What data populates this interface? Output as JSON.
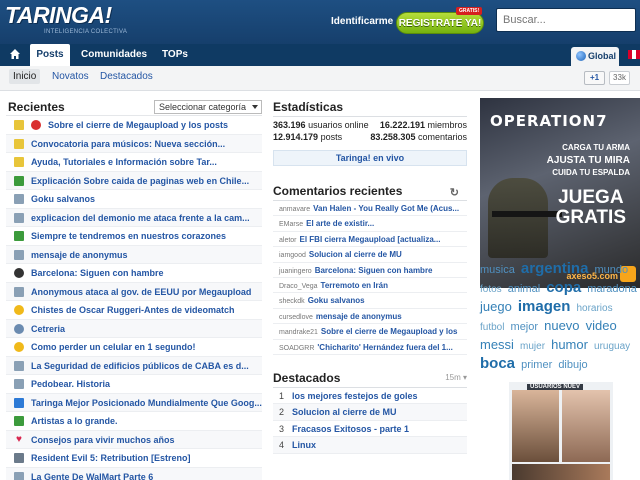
{
  "header": {
    "logo": "TARINGA!",
    "logo_sub": "INTELIGENCIA COLECTIVA",
    "login": "Identificarme",
    "register": "REGISTRATE YA!",
    "badge": "GRATIS!",
    "search_placeholder": "Buscar..."
  },
  "nav": {
    "tabs": [
      "Posts",
      "Comunidades",
      "TOPs"
    ],
    "global": "Global"
  },
  "subnav": {
    "items": [
      "Inicio",
      "Novatos",
      "Destacados"
    ],
    "gplus": "+1",
    "gcount": "33k"
  },
  "recientes": {
    "title": "Recientes",
    "select": "Seleccionar categoría",
    "posts": [
      {
        "text": "Sobre el cierre de Megaupload y los posts",
        "icon": "sticky-icon",
        "color": "#e8c53a"
      },
      {
        "text": "Convocatoria para músicos: Nueva sección...",
        "icon": "sticky-icon",
        "color": "#e8c53a"
      },
      {
        "text": "Ayuda, Tutoriales e Información sobre Tar...",
        "icon": "sticky-icon",
        "color": "#e8c53a"
      },
      {
        "text": "Explicación Sobre caida de paginas web en Chile...",
        "icon": "info-icon",
        "color": "#3c9b3c"
      },
      {
        "text": "Goku salvanos",
        "icon": "book-icon",
        "color": "#8aa0b5"
      },
      {
        "text": "explicacion del demonio me ataca frente a la cam...",
        "icon": "info-icon",
        "color": "#8aa0b5"
      },
      {
        "text": "Siempre te tendremos en nuestros corazones",
        "icon": "info-icon",
        "color": "#3c9b3c"
      },
      {
        "text": "mensaje de anonymus",
        "icon": "info-icon",
        "color": "#8aa0b5"
      },
      {
        "text": "Barcelona: Siguen con hambre",
        "icon": "ball-icon",
        "color": "#333333"
      },
      {
        "text": "Anonymous ataca al gov. de EEUU por Megaupload",
        "icon": "news-icon",
        "color": "#8aa0b5"
      },
      {
        "text": "Chistes de Oscar Ruggeri-Antes de videomatch",
        "icon": "smile-icon",
        "color": "#f0b91a"
      },
      {
        "text": "Cetreria",
        "icon": "globe-icon",
        "color": "#6b8bb0"
      },
      {
        "text": "Como perder un celular en 1 segundo!",
        "icon": "smile-icon",
        "color": "#f0b91a"
      },
      {
        "text": "La Seguridad de edificios públicos de CABA es d...",
        "icon": "news-icon",
        "color": "#8aa0b5"
      },
      {
        "text": "Pedobear. Historia",
        "icon": "info-icon",
        "color": "#8aa0b5"
      },
      {
        "text": "Taringa Mejor Posicionado Mundialmente Que Goog...",
        "icon": "t-icon",
        "color": "#2d7ad6"
      },
      {
        "text": "Artistas a lo grande.",
        "icon": "info-icon",
        "color": "#3c9b3c"
      },
      {
        "text": "Consejos para vivir muchos años",
        "icon": "heart-icon",
        "color": "#d8264f"
      },
      {
        "text": "Resident Evil 5: Retribution [Estreno]",
        "icon": "film-icon",
        "color": "#6b7a8a"
      },
      {
        "text": "La Gente De WalMart Parte 6",
        "icon": "info-icon",
        "color": "#8aa0b5"
      }
    ]
  },
  "estadisticas": {
    "title": "Estadísticas",
    "online_num": "363.196",
    "online_label": "usuarios online",
    "members_num": "16.222.191",
    "members_label": "miembros",
    "posts_num": "12.914.179",
    "posts_label": "posts",
    "comments_num": "83.258.305",
    "comments_label": "comentarios",
    "vivo": "Taringa! en vivo"
  },
  "comentarios": {
    "title": "Comentarios recientes",
    "items": [
      {
        "user": "anmavare",
        "post": "Van Halen - You Really Got Me (Acus..."
      },
      {
        "user": "EMarse",
        "post": "El arte de existir..."
      },
      {
        "user": "aletor",
        "post": "El FBI cierra Megaupload [actualiza..."
      },
      {
        "user": "iamgood",
        "post": "Solucion al cierre de MU"
      },
      {
        "user": "juaningero",
        "post": "Barcelona: Siguen con hambre"
      },
      {
        "user": "Draco_Vega",
        "post": "Terremoto en Irán"
      },
      {
        "user": "sheckdk",
        "post": "Goku salvanos"
      },
      {
        "user": "cursedlove",
        "post": "mensaje de anonymus"
      },
      {
        "user": "mandrake21",
        "post": "Sobre el cierre de Megaupload y los"
      },
      {
        "user": "SOADGRR",
        "post": "'Chicharito' Hernández fuera del 1..."
      }
    ]
  },
  "destacados": {
    "title": "Destacados",
    "time": "15m",
    "items": [
      {
        "n": "1",
        "text": "los mejores festejos de goles"
      },
      {
        "n": "2",
        "text": "Solucion al cierre de MU"
      },
      {
        "n": "3",
        "text": "Fracasos Exitosos - parte 1"
      },
      {
        "n": "4",
        "text": "Linux"
      }
    ]
  },
  "ad": {
    "title": "OPERATION7",
    "line1": "CARGA TU ARMA",
    "line2": "AJUSTA TU MIRA",
    "line3": "CUIDA TU ESPALDA",
    "juega": "JUEGA",
    "gratis": "GRATIS",
    "brand": "axeso5.com"
  },
  "tags": [
    {
      "t": "musica",
      "s": "s2"
    },
    {
      "t": "argentina",
      "s": "s4"
    },
    {
      "t": "mundo",
      "s": "s2"
    },
    {
      "t": "fotos",
      "s": "s1"
    },
    {
      "t": "animal",
      "s": "s2"
    },
    {
      "t": "copa",
      "s": "s4"
    },
    {
      "t": "maradona",
      "s": "s2"
    },
    {
      "t": "juego",
      "s": "s3"
    },
    {
      "t": "imagen",
      "s": "s4"
    },
    {
      "t": "horarios",
      "s": "s1"
    },
    {
      "t": "futbol",
      "s": "s1"
    },
    {
      "t": "mejor",
      "s": "s2"
    },
    {
      "t": "nuevo",
      "s": "s3"
    },
    {
      "t": "video",
      "s": "s3"
    },
    {
      "t": "messi",
      "s": "s3"
    },
    {
      "t": "mujer",
      "s": "s1"
    },
    {
      "t": "humor",
      "s": "s3"
    },
    {
      "t": "uruguay",
      "s": "s1"
    },
    {
      "t": "boca",
      "s": "s4"
    },
    {
      "t": "primer",
      "s": "s2"
    },
    {
      "t": "dibujo",
      "s": "s2"
    }
  ],
  "users_label": "USUARIOS NUEV"
}
